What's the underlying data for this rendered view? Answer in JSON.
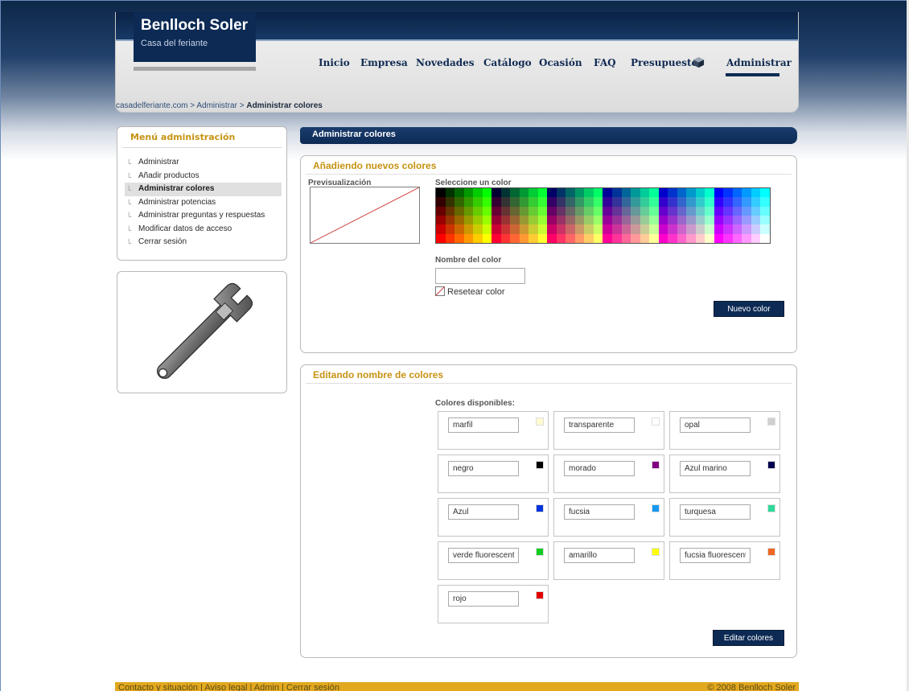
{
  "site": {
    "title": "Benlloch Soler",
    "subtitle": "Casa del feriante"
  },
  "nav": {
    "items": [
      {
        "label": "Inicio"
      },
      {
        "label": "Empresa"
      },
      {
        "label": "Novedades"
      },
      {
        "label": "Catálogo"
      },
      {
        "label": "Ocasión"
      },
      {
        "label": "FAQ"
      },
      {
        "label": "Presupuesto",
        "icon": "cube-icon"
      },
      {
        "label": "Administrar",
        "active": true
      }
    ]
  },
  "breadcrumb": {
    "home": "casadelferiante.com",
    "sep1": " > ",
    "parent": "Administrar",
    "sep2": " > ",
    "current": "Administrar colores"
  },
  "sidebar": {
    "title": "Menú administración",
    "items": [
      {
        "label": "Administrar"
      },
      {
        "label": "Añadir productos"
      },
      {
        "label": "Administrar colores",
        "active": true
      },
      {
        "label": "Administrar potencias"
      },
      {
        "label": "Administrar preguntas y respuestas"
      },
      {
        "label": "Modificar datos de acceso"
      },
      {
        "label": "Cerrar sesión"
      }
    ],
    "image_icon": "wrench-icon"
  },
  "main": {
    "title": "Administrar colores",
    "add_section": {
      "title": "Añadiendo nuevos colores",
      "preview_label": "Previsualización",
      "select_label": "Seleccione un color",
      "name_label": "Nombre del color",
      "name_value": "",
      "reset_label": "Resetear color",
      "submit_label": "Nuevo color"
    },
    "edit_section": {
      "title": "Editando nombre de colores",
      "available_label": "Colores disponibles:",
      "colors": [
        {
          "name": "marfil",
          "swatch": "#fffbd0"
        },
        {
          "name": "transparente",
          "swatch": "#ffffff"
        },
        {
          "name": "opal",
          "swatch": "#cfcfcf"
        },
        {
          "name": "negro",
          "swatch": "#000000"
        },
        {
          "name": "morado",
          "swatch": "#800080"
        },
        {
          "name": "Azul marino",
          "swatch": "#000050"
        },
        {
          "name": "Azul",
          "swatch": "#0033dd"
        },
        {
          "name": "fucsia",
          "swatch": "#1799f0"
        },
        {
          "name": "turquesa",
          "swatch": "#2ed99a"
        },
        {
          "name": "verde fluorescente",
          "swatch": "#13cc22"
        },
        {
          "name": "amarillo",
          "swatch": "#ffff00"
        },
        {
          "name": "fucsia fluorescente",
          "swatch": "#ee6622"
        },
        {
          "name": "rojo",
          "swatch": "#e00000"
        }
      ],
      "submit_label": "Editar colores"
    }
  },
  "footer": {
    "links": "Contacto y situación  |  Aviso legal  |  Admin  |  Cerrar sesión",
    "copyright": "© 2008 Benlloch Soler"
  }
}
